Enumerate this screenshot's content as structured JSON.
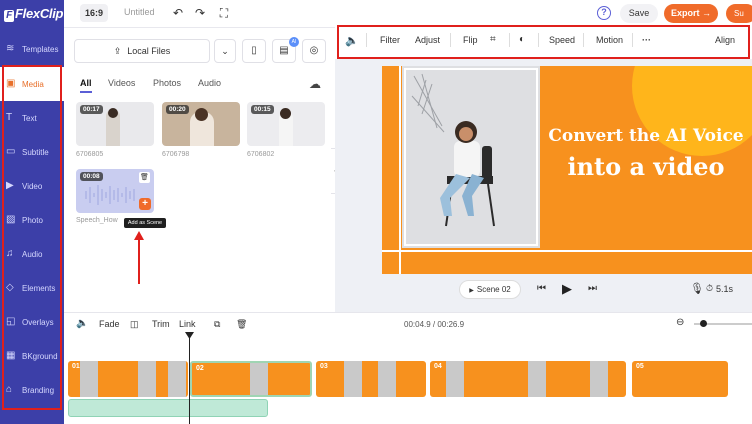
{
  "app": {
    "name": "FlexClip"
  },
  "topbar": {
    "ratio": "16:9",
    "title": "Untitled",
    "save": "Save",
    "export": "Export →",
    "share": "Su"
  },
  "sidebar": {
    "items": [
      {
        "label": "Templates",
        "icon": "layers-icon"
      },
      {
        "label": "Media",
        "icon": "media-icon",
        "active": true
      },
      {
        "label": "Text",
        "icon": "text-icon"
      },
      {
        "label": "Subtitle",
        "icon": "subtitle-icon"
      },
      {
        "label": "Video",
        "icon": "video-icon"
      },
      {
        "label": "Photo",
        "icon": "photo-icon"
      },
      {
        "label": "Audio",
        "icon": "music-icon"
      },
      {
        "label": "Elements",
        "icon": "elements-icon"
      },
      {
        "label": "Overlays",
        "icon": "overlays-icon"
      },
      {
        "label": "BKground",
        "icon": "background-icon"
      },
      {
        "label": "Branding",
        "icon": "branding-icon"
      }
    ]
  },
  "panel": {
    "local_files": "Local Files",
    "ai_badge": "AI",
    "tabs": [
      "All",
      "Videos",
      "Photos",
      "Audio"
    ],
    "media": [
      {
        "duration": "00:17",
        "caption": "6706805"
      },
      {
        "duration": "00:20",
        "caption": "6706798"
      },
      {
        "duration": "00:15",
        "caption": "6706802"
      },
      {
        "duration": "00:08",
        "caption": "Speech_How"
      }
    ],
    "tooltip": "Add as Scene"
  },
  "edit_toolbar": [
    "Filter",
    "Adjust",
    "Flip",
    "Speed",
    "Motion",
    "Align"
  ],
  "preview": {
    "line1": "Convert the AI Voice",
    "line2": "into a video",
    "scene": "Scene 02",
    "duration": "5.1s"
  },
  "timeline": {
    "tools": [
      "Fade",
      "Trim",
      "Link"
    ],
    "time": "00:04.9 / 00:26.9",
    "clips": [
      "01",
      "02",
      "03",
      "04",
      "05"
    ]
  },
  "colors": {
    "sidebar": "#3c3fa8",
    "accent": "#f06b2a",
    "canvas": "#f7911e",
    "highlight": "#e0201c"
  }
}
